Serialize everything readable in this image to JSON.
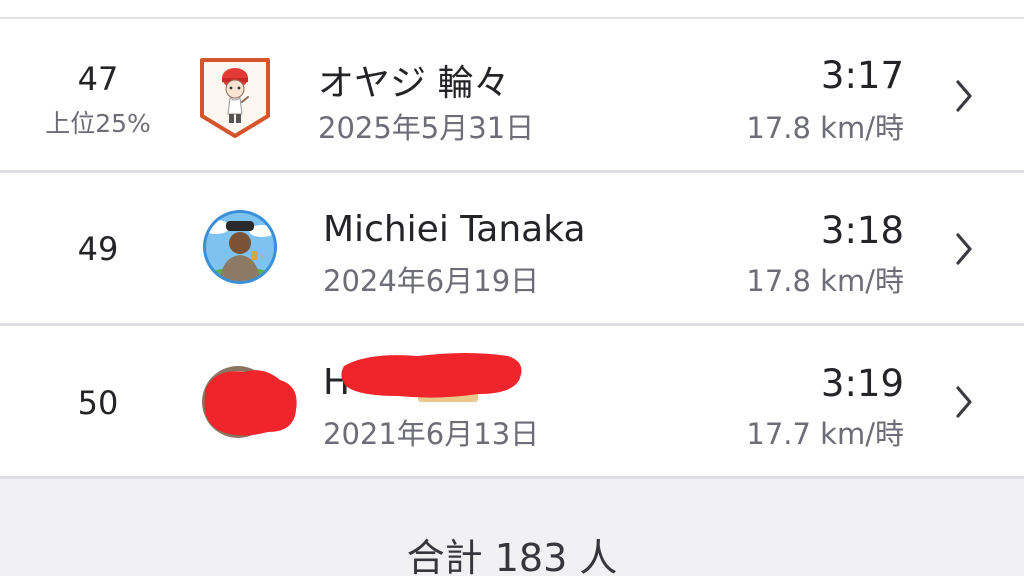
{
  "leaderboard": {
    "rows": [
      {
        "rank": "47",
        "rank_sub": "上位25%",
        "name": "オヤジ 輪々",
        "date": "2025年5月31日",
        "time": "3:17",
        "speed": "17.8 km/時",
        "avatar_icon": "cyclist-cartoon-badge-icon"
      },
      {
        "rank": "49",
        "name": "Michiei Tanaka",
        "date": "2024年6月19日",
        "time": "3:18",
        "speed": "17.8 km/時",
        "avatar_icon": "profile-photo-icon"
      },
      {
        "rank": "50",
        "name": "H",
        "date": "2021年6月13日",
        "time": "3:19",
        "speed": "17.7 km/時",
        "avatar_icon": "redacted-avatar-icon"
      }
    ]
  },
  "footer": {
    "total": "合計 183 人"
  },
  "colors": {
    "primary_text": "#242428",
    "secondary_text": "#6d6d78",
    "divider": "#dedee2",
    "footer_bg": "#f1f1f3",
    "badge_orange": "#d4542b",
    "redaction": "#f0252b"
  }
}
